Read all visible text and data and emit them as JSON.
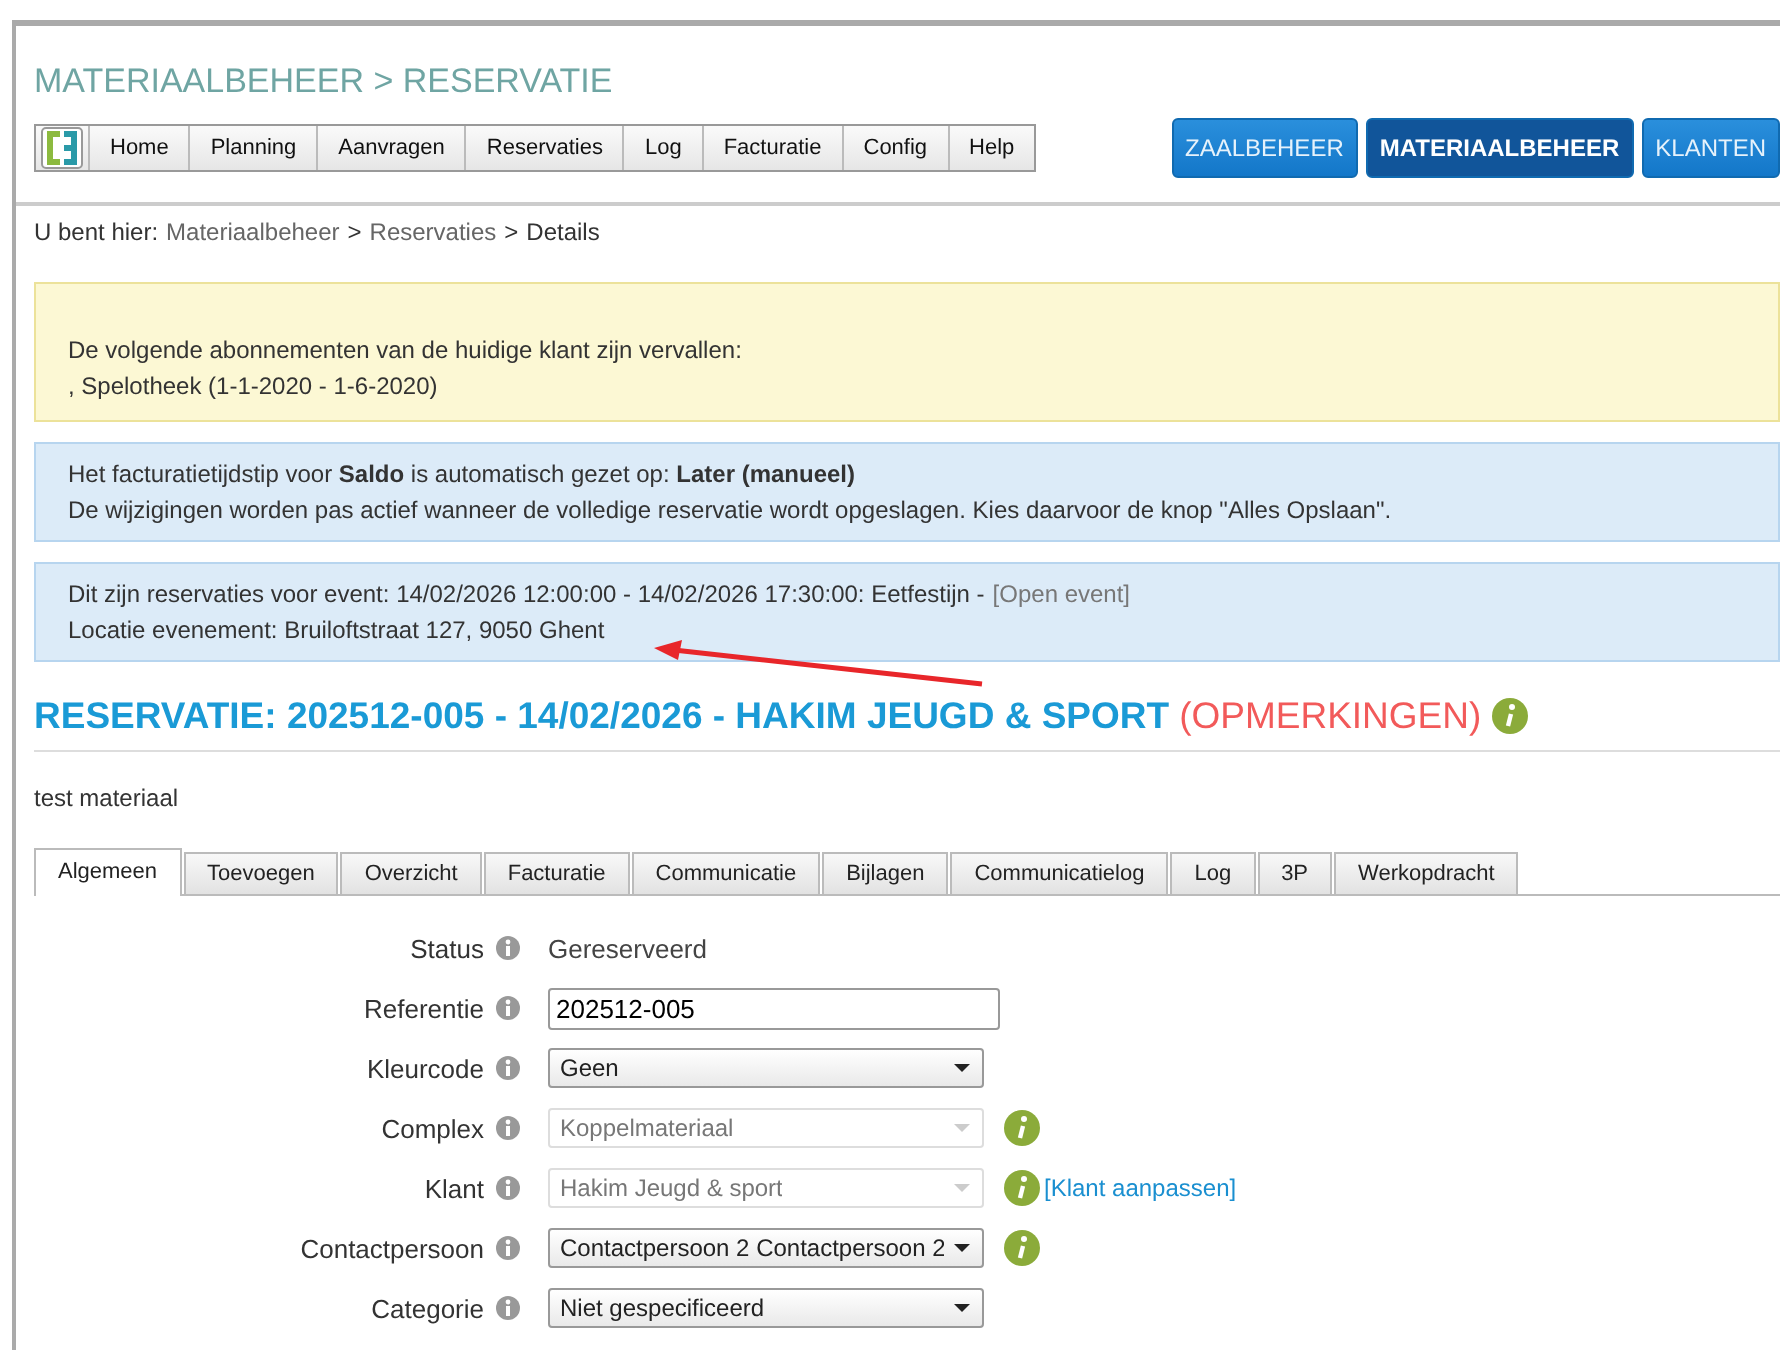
{
  "page_title": "MATERIAALBEHEER > RESERVATIE",
  "menu": [
    "Home",
    "Planning",
    "Aanvragen",
    "Reservaties",
    "Log",
    "Facturatie",
    "Config",
    "Help"
  ],
  "modules": [
    {
      "label": "ZAALBEHEER",
      "selected": false
    },
    {
      "label": "MATERIAALBEHEER",
      "selected": true
    },
    {
      "label": "KLANTEN",
      "selected": false
    }
  ],
  "breadcrumb": {
    "prefix": "U bent hier:",
    "links": [
      "Materiaalbeheer",
      "Reservaties"
    ],
    "separator": ">",
    "current": "Details"
  },
  "notices": [
    {
      "kind": "warning",
      "lines": [
        "De volgende abonnementen van de huidige klant zijn vervallen:",
        ", Spelotheek (1-1-2020 - 1-6-2020)"
      ]
    },
    {
      "kind": "info",
      "lines": [
        "Het facturatietijdstip voor **Saldo** is automatisch gezet op: **Later (manueel)**",
        "De wijzigingen worden pas actief wanneer de volledige reservatie wordt opgeslagen. Kies daarvoor de knop \"Alles Opslaan\"."
      ]
    },
    {
      "kind": "info",
      "lines": [
        "Dit zijn reservaties voor event: 14/02/2026 12:00:00 - 14/02/2026 17:30:00: Eetfestijn -",
        "Locatie evenement: Bruiloftstraat 127, 9050 Ghent"
      ],
      "link": "[Open event]"
    }
  ],
  "heading": {
    "text": "RESERVATIE: 202512-005 - 14/02/2026 - HAKIM JEUGD & SPORT",
    "remark": "(OPMERKINGEN)"
  },
  "description": "test materiaal",
  "tabs": [
    {
      "label": "Algemeen",
      "selected": true
    },
    {
      "label": "Toevoegen",
      "selected": false
    },
    {
      "label": "Overzicht",
      "selected": false
    },
    {
      "label": "Facturatie",
      "selected": false
    },
    {
      "label": "Communicatie",
      "selected": false
    },
    {
      "label": "Bijlagen",
      "selected": false
    },
    {
      "label": "Communicatielog",
      "selected": false
    },
    {
      "label": "Log",
      "selected": false
    },
    {
      "label": "3P",
      "selected": false
    },
    {
      "label": "Werkopdracht",
      "selected": false
    }
  ],
  "form": [
    {
      "label": "Status",
      "kind": "text",
      "value": "Gereserveerd"
    },
    {
      "label": "Referentie",
      "kind": "input",
      "value": "202512-005"
    },
    {
      "label": "Kleurcode",
      "kind": "select",
      "value": "Geen",
      "disabled": false
    },
    {
      "label": "Complex",
      "kind": "select",
      "value": "Koppelmateriaal",
      "disabled": true,
      "info": true
    },
    {
      "label": "Klant",
      "kind": "select",
      "value": "Hakim Jeugd & sport",
      "disabled": true,
      "info": true,
      "link": "[Klant aanpassen]"
    },
    {
      "label": "Contactpersoon",
      "kind": "select",
      "value": "Contactpersoon 2 Contactpersoon 2",
      "disabled": false,
      "info": true
    },
    {
      "label": "Categorie",
      "kind": "select",
      "value": "Niet gespecificeerd",
      "disabled": false
    }
  ]
}
